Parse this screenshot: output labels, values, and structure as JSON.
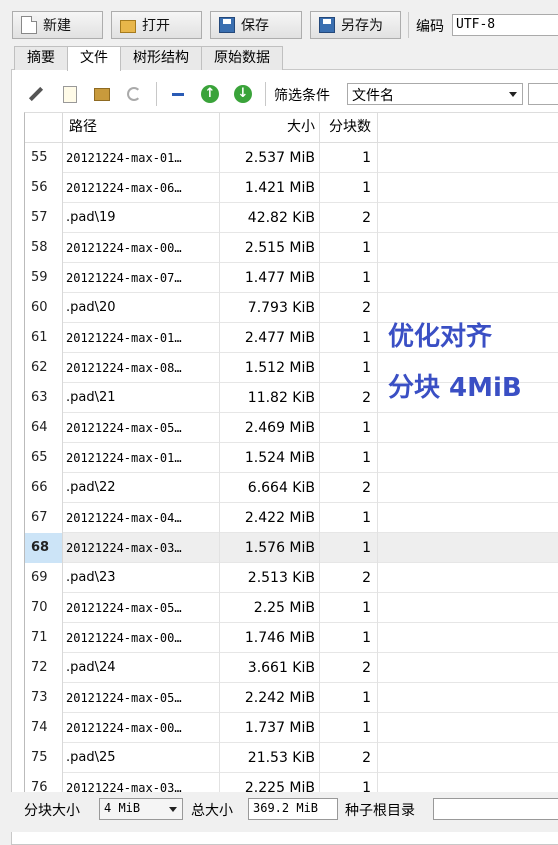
{
  "toolbar": {
    "new_label": "新建",
    "open_label": "打开",
    "save_label": "保存",
    "saveas_label": "另存为",
    "encoding_label": "编码",
    "encoding_value": "UTF-8"
  },
  "tabs": [
    {
      "label": "摘要"
    },
    {
      "label": "文件"
    },
    {
      "label": "树形结构"
    },
    {
      "label": "原始数据"
    }
  ],
  "filter": {
    "label": "筛选条件",
    "selected": "文件名"
  },
  "table": {
    "headers": {
      "path": "路径",
      "size": "大小",
      "blocks": "分块数"
    },
    "rows": [
      {
        "idx": "55",
        "path": "20121224-max-01…",
        "size": "2.537 MiB",
        "blocks": "1"
      },
      {
        "idx": "56",
        "path": "20121224-max-06…",
        "size": "1.421 MiB",
        "blocks": "1"
      },
      {
        "idx": "57",
        "path": ".pad\\19",
        "size": "42.82 KiB",
        "blocks": "2"
      },
      {
        "idx": "58",
        "path": "20121224-max-00…",
        "size": "2.515 MiB",
        "blocks": "1"
      },
      {
        "idx": "59",
        "path": "20121224-max-07…",
        "size": "1.477 MiB",
        "blocks": "1"
      },
      {
        "idx": "60",
        "path": ".pad\\20",
        "size": "7.793 KiB",
        "blocks": "2"
      },
      {
        "idx": "61",
        "path": "20121224-max-01…",
        "size": "2.477 MiB",
        "blocks": "1"
      },
      {
        "idx": "62",
        "path": "20121224-max-08…",
        "size": "1.512 MiB",
        "blocks": "1"
      },
      {
        "idx": "63",
        "path": ".pad\\21",
        "size": "11.82 KiB",
        "blocks": "2"
      },
      {
        "idx": "64",
        "path": "20121224-max-05…",
        "size": "2.469 MiB",
        "blocks": "1"
      },
      {
        "idx": "65",
        "path": "20121224-max-01…",
        "size": "1.524 MiB",
        "blocks": "1"
      },
      {
        "idx": "66",
        "path": ".pad\\22",
        "size": "6.664 KiB",
        "blocks": "2"
      },
      {
        "idx": "67",
        "path": "20121224-max-04…",
        "size": "2.422 MiB",
        "blocks": "1"
      },
      {
        "idx": "68",
        "path": "20121224-max-03…",
        "size": "1.576 MiB",
        "blocks": "1",
        "selected": true
      },
      {
        "idx": "69",
        "path": ".pad\\23",
        "size": "2.513 KiB",
        "blocks": "2"
      },
      {
        "idx": "70",
        "path": "20121224-max-05…",
        "size": "2.25 MiB",
        "blocks": "1"
      },
      {
        "idx": "71",
        "path": "20121224-max-00…",
        "size": "1.746 MiB",
        "blocks": "1"
      },
      {
        "idx": "72",
        "path": ".pad\\24",
        "size": "3.661 KiB",
        "blocks": "2"
      },
      {
        "idx": "73",
        "path": "20121224-max-05…",
        "size": "2.242 MiB",
        "blocks": "1"
      },
      {
        "idx": "74",
        "path": "20121224-max-00…",
        "size": "1.737 MiB",
        "blocks": "1"
      },
      {
        "idx": "75",
        "path": ".pad\\25",
        "size": "21.53 KiB",
        "blocks": "2"
      },
      {
        "idx": "76",
        "path": "20121224-max-03…",
        "size": "2.225 MiB",
        "blocks": "1"
      }
    ]
  },
  "overlay": {
    "line1": "优化对齐",
    "line2": "分块 4MiB"
  },
  "bottom": {
    "block_size_label": "分块大小",
    "block_size_value": "4 MiB",
    "total_size_label": "总大小",
    "total_size_value": "369.2 MiB",
    "seed_root_label": "种子根目录",
    "seed_root_value": ""
  },
  "colors": {
    "overlay_text": "#3a4fc4",
    "selected_index_bg": "#cce4f7"
  },
  "icons": [
    "document-new-icon",
    "folder-open-icon",
    "save-icon",
    "save-as-icon",
    "magic-wand-icon",
    "new-file-icon",
    "folder-icon",
    "refresh-icon",
    "minus-icon",
    "arrow-up-icon",
    "arrow-down-icon"
  ]
}
